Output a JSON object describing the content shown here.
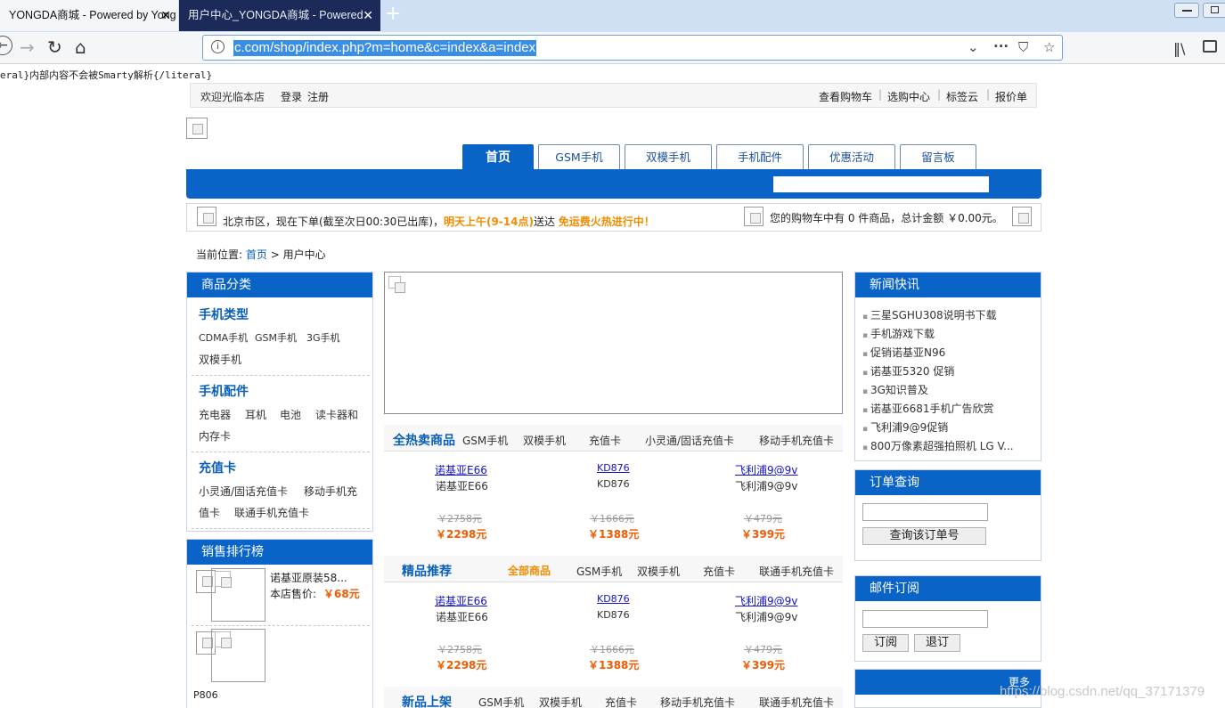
{
  "browser": {
    "tabs": [
      {
        "title": "YONGDA商城 - Powered by Yong"
      },
      {
        "title": "用户中心_YONGDA商城 - Powered"
      }
    ],
    "url": "c.com/shop/index.php?m=home&c=index&a=index"
  },
  "literal_note": "eral}内部内容不会被Smarty解析{/literal}",
  "topbar": {
    "welcome": "欢迎光临本店",
    "login": "登录",
    "register": "注册",
    "links": [
      "查看购物车",
      "选购中心",
      "标签云",
      "报价单"
    ]
  },
  "nav": {
    "tabs": [
      "首页",
      "GSM手机",
      "双模手机",
      "手机配件",
      "优惠活动",
      "留言板"
    ]
  },
  "infobar": {
    "delivery": "北京市区，现在下单(截至次日00:30已出库)，",
    "delivery_time": "明天上午(9-14点)",
    "delivery_end": "送达",
    "promo": "免运费火热进行中！",
    "cart": "您的购物车中有 0 件商品，总计金额 ￥0.00元。"
  },
  "breadcrumb": {
    "label": "当前位置:",
    "home": "首页",
    "sep": ">",
    "current": "用户中心"
  },
  "category": {
    "title": "商品分类",
    "groups": [
      {
        "name": "手机类型",
        "line1": [
          "CDMA手机",
          "GSM手机",
          "3G手机"
        ],
        "line2": [
          "双模手机"
        ]
      },
      {
        "name": "手机配件",
        "line1": [
          "充电器",
          "耳机",
          "电池",
          "读卡器和"
        ],
        "line2": [
          "内存卡"
        ]
      },
      {
        "name": "充值卡",
        "line1": [
          "小灵通/固话充值卡",
          "移动手机充"
        ],
        "line2": [
          "值卡",
          "联通手机充值卡"
        ]
      }
    ]
  },
  "sales_rank": {
    "title": "销售排行榜",
    "items": [
      {
        "name": "诺基亚原装58...",
        "price_label": "本店售价:",
        "price": "￥68元"
      },
      {
        "name": "P806"
      }
    ]
  },
  "news": {
    "title": "新闻快讯",
    "items": [
      "三星SGHU308说明书下载",
      "手机游戏下载",
      "促销诺基亚N96",
      "诺基亚5320 促销",
      "3G知识普及",
      "诺基亚6681手机广告欣赏",
      "飞利浦9@9促销",
      "800万像素超强拍照机 LG V..."
    ]
  },
  "order_query": {
    "title": "订单查询",
    "button": "查询该订单号"
  },
  "mail_sub": {
    "title": "邮件订阅",
    "subscribe": "订阅",
    "unsubscribe": "退订"
  },
  "more_box": {
    "more": "更多"
  },
  "sections": [
    {
      "title": "全热卖商品",
      "tabs": [
        "GSM手机",
        "双模手机",
        "充值卡",
        "小灵通/固话充值卡",
        "移动手机充值卡"
      ],
      "products": [
        {
          "link": "诺基亚E66",
          "name": "诺基亚E66",
          "old": "￥2758元",
          "price": "￥2298元"
        },
        {
          "link": "KD876",
          "name": "KD876",
          "old": "￥1666元",
          "price": "￥1388元"
        },
        {
          "link": "飞利浦9@9v",
          "name": "飞利浦9@9v",
          "old": "￥479元",
          "price": "￥399元"
        }
      ]
    },
    {
      "title": "精品推荐",
      "tabs": [
        "全部商品",
        "GSM手机",
        "双模手机",
        "充值卡",
        "联通手机充值卡"
      ],
      "products": [
        {
          "link": "诺基亚E66",
          "name": "诺基亚E66",
          "old": "￥2758元",
          "price": "￥2298元"
        },
        {
          "link": "KD876",
          "name": "KD876",
          "old": "￥1666元",
          "price": "￥1388元"
        },
        {
          "link": "飞利浦9@9v",
          "name": "飞利浦9@9v",
          "old": "￥479元",
          "price": "￥399元"
        }
      ]
    },
    {
      "title": "新品上架",
      "tabs": [
        "GSM手机",
        "双模手机",
        "充值卡",
        "移动手机充值卡",
        "联通手机充值卡"
      ]
    }
  ],
  "watermark": "https://blog.csdn.net/qq_37171379",
  "colors": {
    "primary": "#0a64c8",
    "accent": "#f08c00",
    "price": "#f05a00"
  }
}
